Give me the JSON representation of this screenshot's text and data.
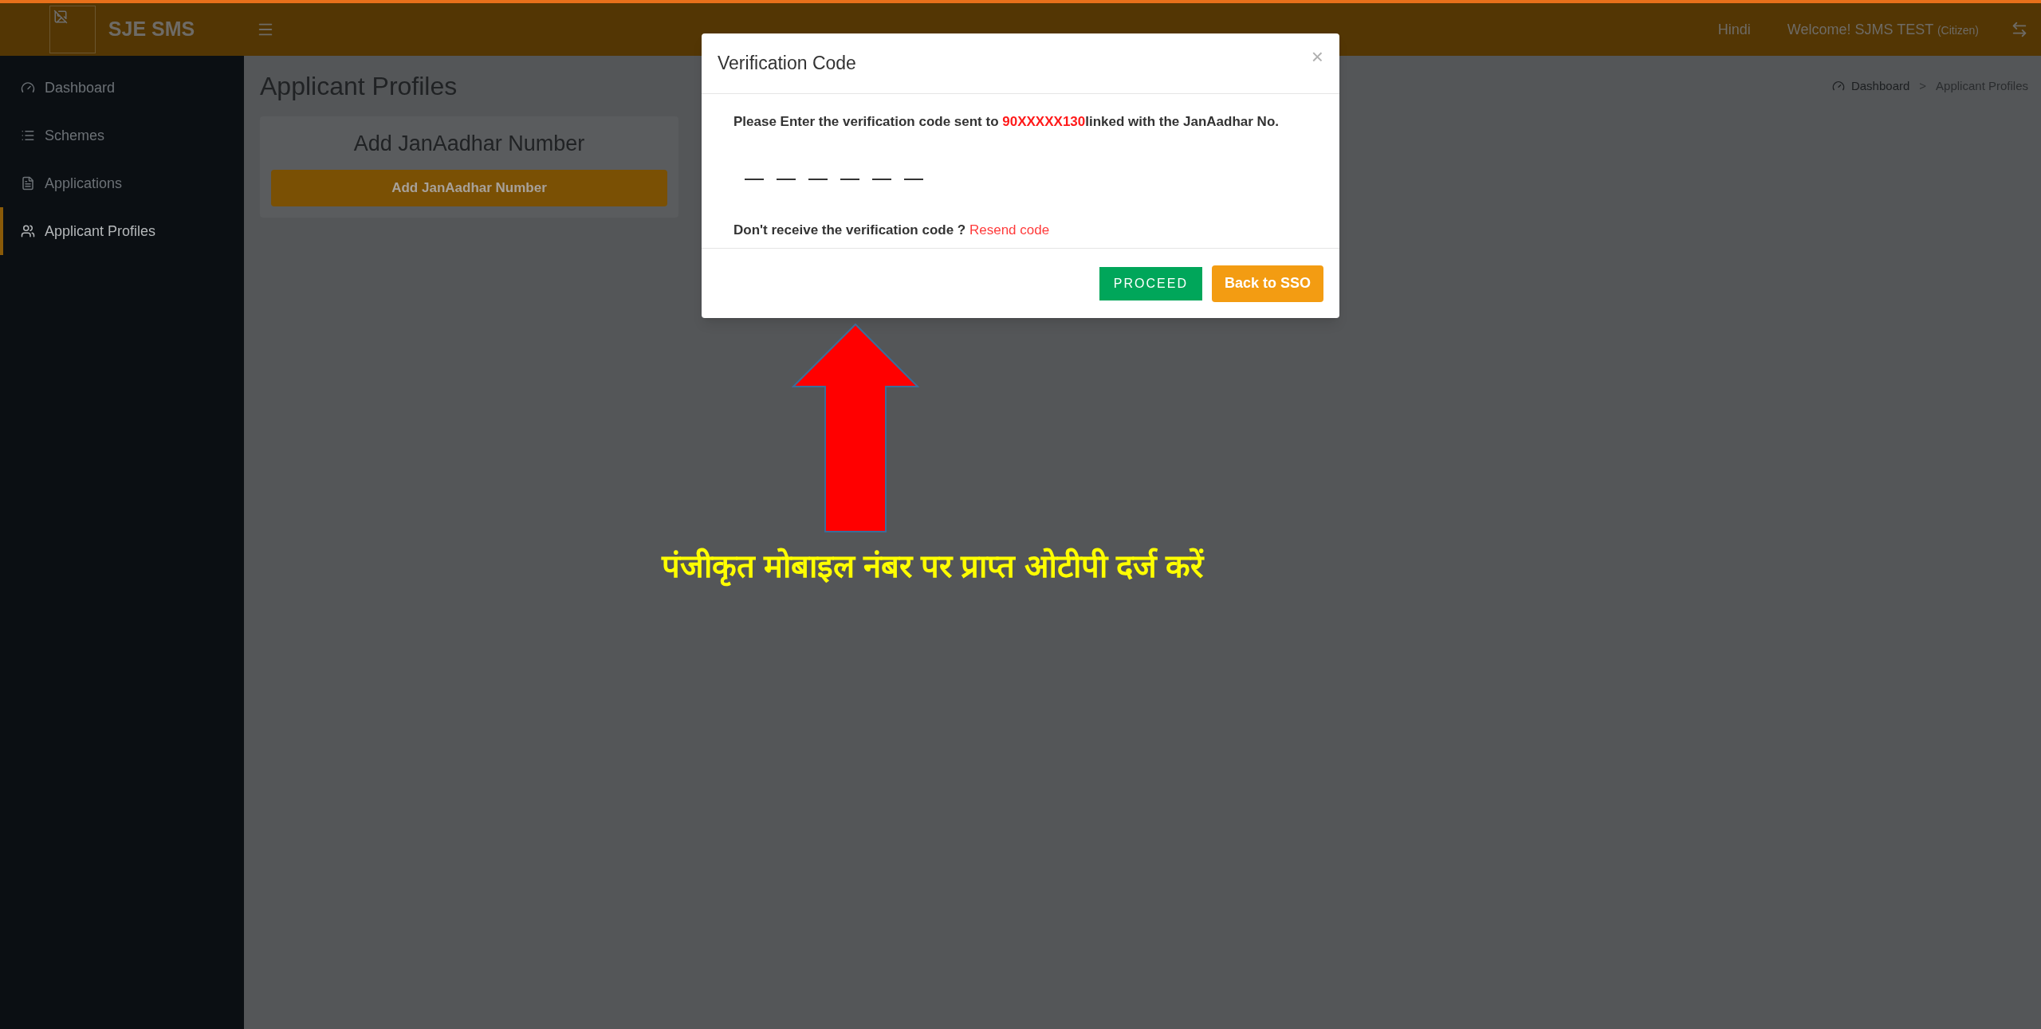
{
  "header": {
    "brand": "SJE SMS",
    "language": "Hindi",
    "welcome": "Welcome! SJMS TEST",
    "role": "(Citizen)"
  },
  "sidebar": {
    "items": [
      {
        "label": "Dashboard",
        "kind": "dashboard",
        "selected": false
      },
      {
        "label": "Schemes",
        "kind": "list",
        "selected": false
      },
      {
        "label": "Applications",
        "kind": "file",
        "selected": false
      },
      {
        "label": "Applicant Profiles",
        "kind": "users",
        "selected": true
      }
    ]
  },
  "page": {
    "title": "Applicant Profiles",
    "breadcrumb": [
      "Dashboard",
      "Applicant Profiles"
    ],
    "breadcrumb_separator": ">"
  },
  "card": {
    "title": "Add JanAadhar Number",
    "button": "Add JanAadhar Number"
  },
  "modal": {
    "title": "Verification Code",
    "close": "×",
    "message_before": "Please Enter the verification code sent to ",
    "masked_number": "90XXXXX130",
    "message_after": "linked with the JanAadhar No.",
    "otp_fields": [
      {
        "filled": false
      },
      {
        "filled": false
      },
      {
        "filled": false
      },
      {
        "filled": false
      },
      {
        "filled": false
      },
      {
        "filled": false
      }
    ],
    "resend_prompt": "Don't receive the verification code ?",
    "resend_link": "Resend code",
    "buttons": [
      {
        "label": "PROCEED",
        "kind": "proceed"
      },
      {
        "label": "Back to SSO",
        "kind": "back"
      }
    ]
  },
  "annotation": {
    "text": "पंजीकृत मोबाइल नंबर पर प्राप्त ओटीपी दर्ज करें"
  }
}
